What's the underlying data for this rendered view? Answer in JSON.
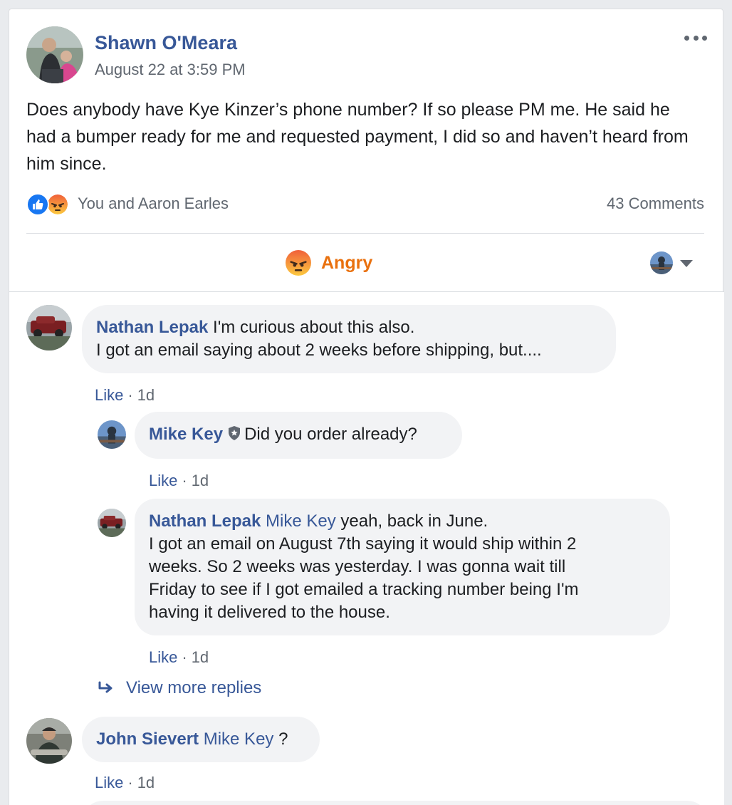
{
  "post": {
    "author": "Shawn O'Meara",
    "timestamp": "August 22 at 3:59 PM",
    "text": "Does anybody have Kye Kinzer’s phone number? If so please PM me. He said he had a bumper ready for me and requested payment, I did so and haven’t heard from him since.",
    "reactions_names": "You and Aaron Earles",
    "comments_count": "43 Comments",
    "reaction_button_label": "Angry"
  },
  "comments": [
    {
      "author": "Nathan Lepak",
      "line1": "I'm curious about this also.",
      "line2": "I got an email saying about 2 weeks before shipping, but....",
      "like_label": "Like",
      "age": "1d"
    },
    {
      "author": "Mike Key",
      "text": "Did you order already?",
      "like_label": "Like",
      "age": "1d"
    },
    {
      "author": "Nathan Lepak",
      "mention": "Mike Key",
      "line1": "yeah, back in June.",
      "line2": "I got an email on August 7th saying it would ship within 2",
      "line3": "weeks. So 2 weeks was yesterday. I was gonna wait till",
      "line4": "Friday to see if I got emailed a tracking number being I'm",
      "line5": "having it delivered to the house.",
      "like_label": "Like",
      "age": "1d"
    },
    {
      "author": "John Sievert",
      "mention": "Mike Key",
      "text": "?",
      "like_label": "Like",
      "age": "1d"
    }
  ],
  "view_more_replies": "View more replies",
  "colors": {
    "link_blue": "#385898",
    "angry_orange": "#e9710f",
    "like_blue": "#1877f2",
    "bubble_bg": "#f2f3f5"
  }
}
